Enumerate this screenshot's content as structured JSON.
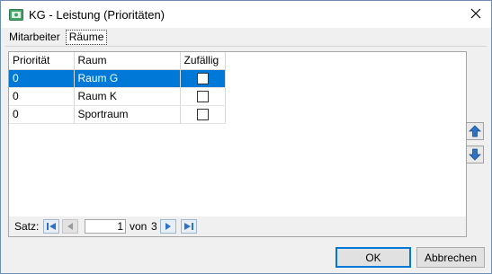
{
  "window": {
    "title": "KG - Leistung (Prioritäten)"
  },
  "tabs": [
    {
      "label": "Mitarbeiter",
      "active": false
    },
    {
      "label": "Räume",
      "active": true
    }
  ],
  "grid": {
    "columns": [
      "Priorität",
      "Raum",
      "Zufällig"
    ],
    "rows": [
      {
        "prioritaet": "0",
        "raum": "Raum G",
        "zufaellig": false,
        "selected": true
      },
      {
        "prioritaet": "0",
        "raum": "Raum K",
        "zufaellig": false,
        "selected": false
      },
      {
        "prioritaet": "0",
        "raum": "Sportraum",
        "zufaellig": false,
        "selected": false
      }
    ]
  },
  "navigator": {
    "label": "Satz:",
    "current": "1",
    "of_label": "von",
    "total": "3"
  },
  "side_buttons": {
    "up_icon": "arrow-up-icon",
    "down_icon": "arrow-down-icon"
  },
  "footer": {
    "ok_label": "OK",
    "cancel_label": "Abbrechen"
  },
  "colors": {
    "selection": "#0078d7",
    "accent_blue": "#2f72c4"
  }
}
